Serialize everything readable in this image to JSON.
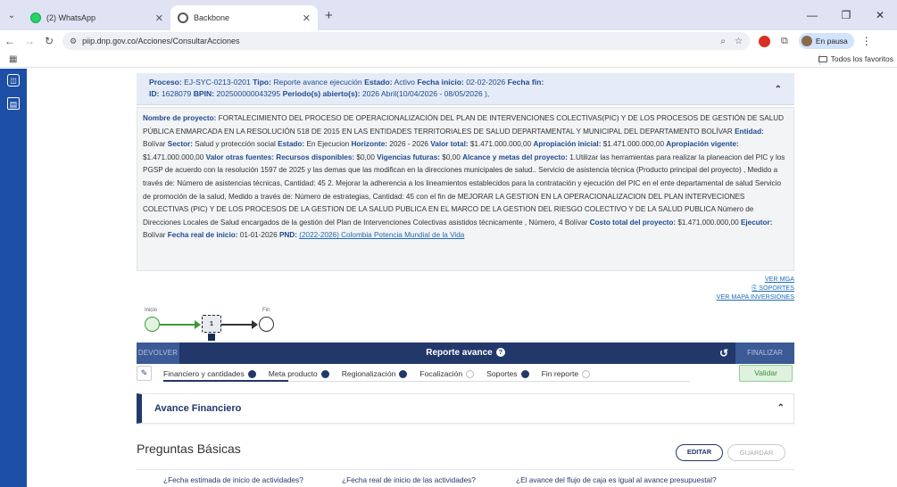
{
  "browser": {
    "tabs": [
      {
        "title": "(2) WhatsApp",
        "icon": "whatsapp-icon"
      },
      {
        "title": "Backbone",
        "icon": "backbone-icon"
      }
    ],
    "url": "piip.dnp.gov.co/Acciones/ConsultarAcciones",
    "profile_label": "En pausa",
    "bookmarks_all": "Todos los favoritos"
  },
  "process": {
    "line1_label_proceso": "Proceso:",
    "proceso": "EJ-SYC-0213-0201",
    "label_tipo": "Tipo:",
    "tipo": "Reporte avance ejecución",
    "label_estado": "Estado:",
    "estado": "Activo",
    "label_inicio": "Fecha inicio:",
    "fecha_inicio": "02-02-2026",
    "label_fin": "Fecha fin:",
    "label_id": "ID:",
    "id": "1628079",
    "label_bpin": "BPIN:",
    "bpin": "202500000043295",
    "label_periodo": "Periodo(s) abierto(s):",
    "periodo": "2026 Abril(10/04/2026 - 08/05/2026 ),"
  },
  "project": {
    "l_nombre": "Nombre de proyecto:",
    "nombre": "FORTALECIMIENTO DEL PROCESO DE OPERACIONALIZACIÓN DEL PLAN DE INTERVENCIONES COLECTIVAS(PIC) Y DE LOS PROCESOS DE GESTIÓN DE SALUD PÚBLICA ENMARCADA EN LA RESOLUCIÓN 518 DE 2015 EN LAS ENTIDADES TERRITORIALES DE SALUD DEPARTAMENTAL Y MUNICIPAL DEL DEPARTAMENTO BOLÍVAR",
    "l_entidad": "Entidad:",
    "entidad": "Bolívar",
    "l_sector": "Sector:",
    "sector": "Salud y protección social",
    "l_estado": "Estado:",
    "estado": "En Ejecucion",
    "l_horizonte": "Horizonte:",
    "horizonte": "2026 - 2026",
    "l_valor_total": "Valor total:",
    "valor_total": "$1.471.000.000,00",
    "l_aprop_inicial": "Apropiación inicial:",
    "aprop_inicial": "$1.471.000.000,00",
    "l_aprop_vigente": "Apropiación vigente:",
    "aprop_vigente": "$1.471.000.000,00",
    "l_otras_fuentes": "Valor otras fuentes:",
    "l_recursos": "Recursos disponibles:",
    "recursos": "$0,00",
    "l_vigencias": "Vigencias futuras:",
    "vigencias": "$0,00",
    "l_alcance": "Alcance y metas del proyecto:",
    "alcance": "1.Utilizar las herramientas para realizar la planeacion del PIC y los PGSP de acuerdo con la resolución 1597 de 2025 y las demas que las modifican en la direcciones municipales de salud.. Servicio de asistencia técnica (Producto principal del proyecto) , Medido a través de: Número de asistencias técnicas, Cantidad: 45 2. Mejorar la adherencia a los lineamientos establecidos para la contratación y ejecución del PIC en el ente departamental de salud Servicio de promoción de la salud, Medido a través de: Número de estrategias, Cantidad: 45 con el fin de MEJORAR LA GESTION EN LA OPERACIONALIZACION DEL PLAN INTERVECIONES COLECTIVAS (PIC) Y DE LOS PROCESOS DE LA GESTION DE LA SALUD PUBLICA EN EL MARCO DE LA GESTION DEL RIESGO COLECTIVO Y DE LA SALUD PUBLICA Número de Direcciones Locales de Salud encargados de la gestión del Plan de Intervenciones Colectivas asistidos técnicamente , Número, 4 Bolívar",
    "l_costo": "Costo total del proyecto:",
    "costo": "$1.471.000.000,00",
    "l_ejecutor": "Ejecutor:",
    "ejecutor": "Bolívar",
    "l_fecha_real": "Fecha real de inicio:",
    "fecha_real": "01-01-2026",
    "l_pnd": "PND:",
    "pnd": "(2022-2026) Colombia Potencia Mundial de la Vida"
  },
  "links": {
    "ver_mga": "VER MGA",
    "soportes": "SOPORTES",
    "ver_mapa": "VER MAPA INVERSIONES"
  },
  "flow": {
    "start_label": "Inicio",
    "end_label": "Fin",
    "task_number": "1"
  },
  "report_bar": {
    "devolver": "DEVOLVER",
    "title": "Reporte avance",
    "finalizar": "FINALIZAR"
  },
  "tabs": [
    {
      "label": "Financiero y cantidades",
      "done": true
    },
    {
      "label": "Meta producto",
      "done": true
    },
    {
      "label": "Regionalización",
      "done": true
    },
    {
      "label": "Focalización",
      "done": false
    },
    {
      "label": "Soportes",
      "done": true
    },
    {
      "label": "Fin reporte",
      "done": false
    }
  ],
  "validar": "Validar",
  "avance_title": "Avance Financiero",
  "preguntas": {
    "title": "Preguntas Básicas",
    "editar": "EDITAR",
    "guardar": "GUARDAR",
    "q1": "¿Fecha estimada de inicio de actividades?",
    "q2": "¿Fecha real de inicio de las actividades?",
    "q3": "¿El avance del flujo de caja es igual al avance presupuestal?"
  },
  "colors": {
    "navy": "#22386a",
    "sidebar_blue": "#1d4fa6",
    "link": "#1f6bb5",
    "validate_green": "#3d8f3d"
  }
}
